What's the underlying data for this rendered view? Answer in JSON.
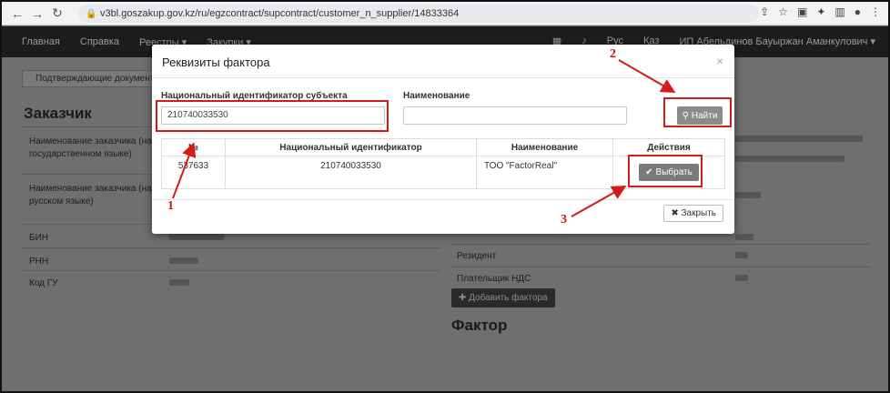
{
  "browser": {
    "url": "v3bl.goszakup.gov.kz/ru/egzcontract/supcontract/customer_n_supplier/14833364"
  },
  "site_nav": {
    "items": [
      "Главная",
      "Справка",
      "Реестры ▾",
      "Закупки ▾"
    ],
    "right_items": [
      "Рус",
      "Қаз",
      "ИП Абельдинов Бауыржан Аманкулович ▾"
    ]
  },
  "page": {
    "crumb": "Подтверждающие документы",
    "section_customer": "Заказчик",
    "labels": {
      "name_state": "Наименование заказчика (на государственном языке)",
      "name_ru": "Наименование заказчика (на русском языке)",
      "bin": "БИН",
      "rnn": "РНН",
      "code_gu": "Код ГУ",
      "resident": "Резидент",
      "vat_payer": "Плательщик НДС"
    },
    "section_factor": "Фактор",
    "add_factor": "Добавить фактора"
  },
  "modal": {
    "title": "Реквизиты фактора",
    "close_x": "×",
    "id_label": "Национальный идентификатор субъекта",
    "id_value": "210740033530",
    "name_label": "Наименование",
    "name_value": "",
    "find_button": "Найти",
    "table": {
      "headers": [
        "№",
        "Национальный идентификатор",
        "Наименование",
        "Действия"
      ],
      "rows": [
        {
          "num": "537633",
          "nid": "210740033530",
          "name": "ТОО \"FactorReal\"",
          "action": "Выбрать"
        }
      ]
    },
    "close_button": "Закрыть"
  },
  "annotations": [
    "1",
    "2",
    "3"
  ],
  "colors": {
    "highlight": "#d51a1a",
    "overlay": "#6f6f6f"
  }
}
